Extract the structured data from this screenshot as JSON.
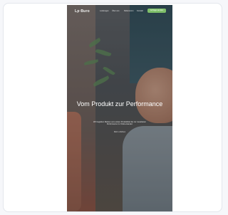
{
  "preview": {
    "logo": "Lp·Buro",
    "nav": [
      "Leistungen",
      "Über uns",
      "Referenzen",
      "Kontakt"
    ],
    "cta": "Anfrage senden",
    "hero_title": "Vom Produkt zur Performance",
    "hero_subtitle": "Wir begleiten Marken vom ersten Produktfoto bis zur messbaren Performance im Online-Handel.",
    "hero_link": "Mehr erfahren",
    "colors": {
      "accent": "#7fbf6a",
      "card_border": "#e3e6ec",
      "background": "#f6f7fa"
    }
  }
}
